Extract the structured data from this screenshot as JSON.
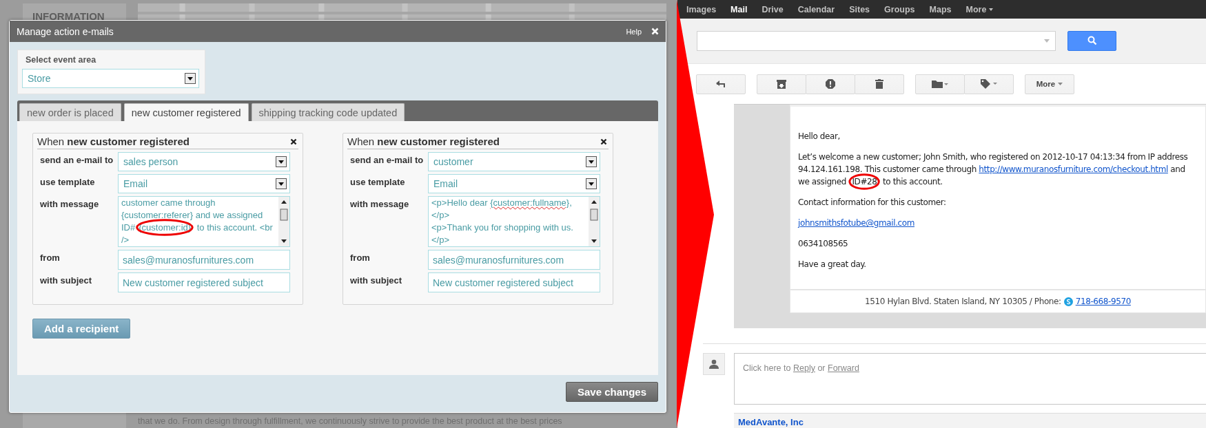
{
  "backdrop": {
    "heading": "INFORMATION",
    "text": "that we do. From design through fulfillment, we continuously strive to provide the best product at the best prices"
  },
  "dialog": {
    "title": "Manage action e-mails",
    "help": "Help",
    "event_area": {
      "label": "Select event area",
      "value": "Store"
    },
    "tabs": [
      {
        "label": "new order is placed",
        "selected": false
      },
      {
        "label": "new customer registered",
        "selected": true
      },
      {
        "label": "shipping tracking code updated",
        "selected": false
      }
    ],
    "rules": [
      {
        "prefix": "When",
        "event": "new customer registered",
        "fields": [
          {
            "label": "send an e-mail to",
            "kind": "select",
            "value": "sales person"
          },
          {
            "label": "use template",
            "kind": "select",
            "value": "Email"
          },
          {
            "label": "with message",
            "kind": "textarea",
            "lines": [
              [
                {
                  "text": "customer came through",
                  "kind": "text"
                }
              ],
              [
                {
                  "text": "{customer:referer} and we assigned",
                  "kind": "text"
                }
              ],
              [
                {
                  "text": "ID#",
                  "kind": "text"
                },
                {
                  "text": "{customer:id}",
                  "kind": "circled"
                },
                {
                  "text": " to this account. <br",
                  "kind": "text"
                }
              ],
              [
                {
                  "text": "/>",
                  "kind": "text"
                }
              ]
            ]
          },
          {
            "label": "from",
            "kind": "input",
            "value": "sales@muranosfurnitures.com"
          },
          {
            "label": "with subject",
            "kind": "input",
            "value": "New customer registered subject"
          }
        ]
      },
      {
        "prefix": "When",
        "event": "new customer registered",
        "fields": [
          {
            "label": "send an e-mail to",
            "kind": "select",
            "value": "customer"
          },
          {
            "label": "use template",
            "kind": "select",
            "value": "Email"
          },
          {
            "label": "with message",
            "kind": "textarea",
            "lines": [
              [
                {
                  "text": "<p>Hello dear ",
                  "kind": "text"
                },
                {
                  "text": "{customer:fullname}",
                  "kind": "misspelled"
                },
                {
                  "text": ",",
                  "kind": "text"
                }
              ],
              [
                {
                  "text": "</p>",
                  "kind": "text"
                }
              ],
              [
                {
                  "text": "<p>Thank you for shopping with us.",
                  "kind": "text"
                }
              ],
              [
                {
                  "text": "</p>",
                  "kind": "text"
                }
              ]
            ]
          },
          {
            "label": "from",
            "kind": "input",
            "value": "sales@muranosfurnitures.com"
          },
          {
            "label": "with subject",
            "kind": "input",
            "value": "New customer registered subject"
          }
        ]
      }
    ],
    "add_button": "Add a recipient",
    "save_button": "Save changes"
  },
  "mail": {
    "nav": [
      {
        "label": "Images",
        "selected": false
      },
      {
        "label": "Mail",
        "selected": true
      },
      {
        "label": "Drive",
        "selected": false
      },
      {
        "label": "Calendar",
        "selected": false
      },
      {
        "label": "Sites",
        "selected": false
      },
      {
        "label": "Groups",
        "selected": false
      },
      {
        "label": "Maps",
        "selected": false
      },
      {
        "label": "More",
        "selected": false
      }
    ],
    "toolbar_more": "More",
    "paragraphs": [
      [
        {
          "text": "Hello dear,",
          "kind": "text"
        }
      ],
      [
        {
          "text": "Let’s welcome a new customer; John Smith, who registered on 2012-10-17 04:13:34 from IP address 94.124.161.198. This customer came through ",
          "kind": "text"
        },
        {
          "text": "http://www.muranosfurniture.com/checkout.html",
          "kind": "link"
        },
        {
          "text": " and we assigned ",
          "kind": "text"
        },
        {
          "text": "ID#28",
          "kind": "circled"
        },
        {
          "text": " to this account.",
          "kind": "text"
        }
      ],
      [
        {
          "text": "Contact information for this customer:",
          "kind": "text"
        }
      ],
      [
        {
          "text": "johnsmithsfotube@gmail.com",
          "kind": "link"
        }
      ],
      [
        {
          "text": "0634108565",
          "kind": "text"
        }
      ],
      [
        {
          "text": "Have a great day.",
          "kind": "text"
        }
      ]
    ],
    "footer": {
      "address": "1510 Hylan Blvd. Staten Island, NY 10305 / Phone:",
      "phone": "718-668-9570"
    },
    "reply": {
      "before": "Click here to",
      "reply": "Reply",
      "or": "or",
      "forward": "Forward"
    },
    "next_sender": "MedAvante, Inc"
  }
}
